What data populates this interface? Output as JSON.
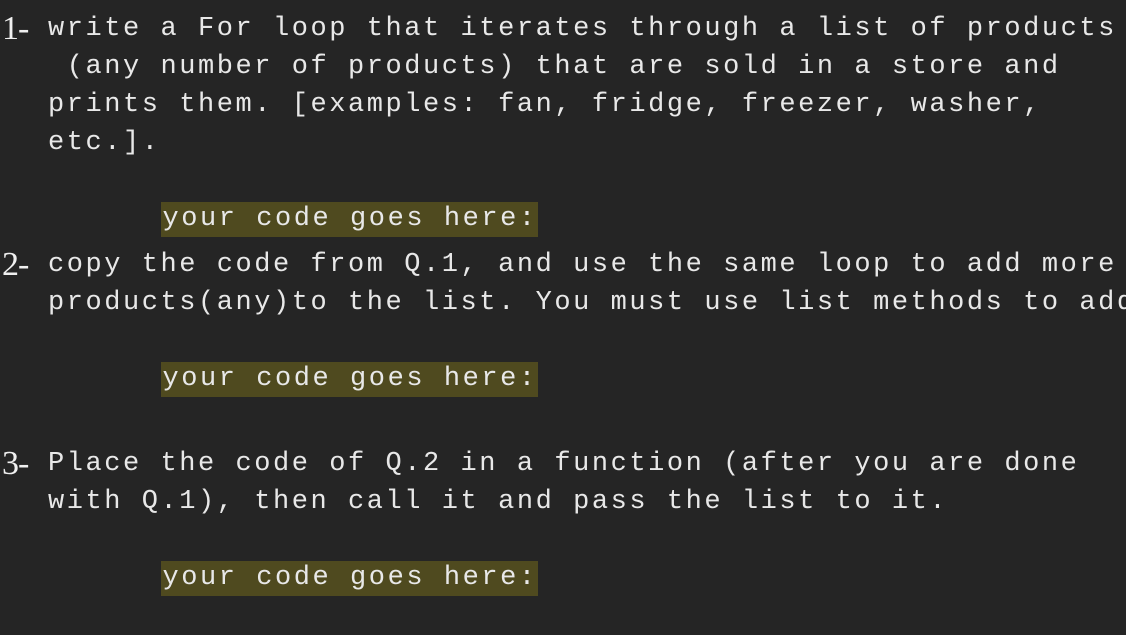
{
  "questions": [
    {
      "number": "1-",
      "lines": [
        "write a For loop that iterates through a list of products",
        " (any number of products) that are sold in a store and",
        "prints them. [examples: fan, fridge, freezer, washer,",
        "etc.]."
      ],
      "answer_prompt": "your code goes here:"
    },
    {
      "number": "2-",
      "lines": [
        "copy the code from Q.1, and use the same loop to add more",
        "products(any)to the list. You must use list methods to add"
      ],
      "answer_prompt": "your code goes here:"
    },
    {
      "number": "3-",
      "lines": [
        "Place the code of Q.2 in a function (after you are done",
        "with Q.1), then call it and pass the list to it."
      ],
      "answer_prompt": "your code goes here:"
    }
  ],
  "colors": {
    "background": "#252525",
    "text": "#e8e8e8",
    "highlight": "#4f4a1f"
  }
}
